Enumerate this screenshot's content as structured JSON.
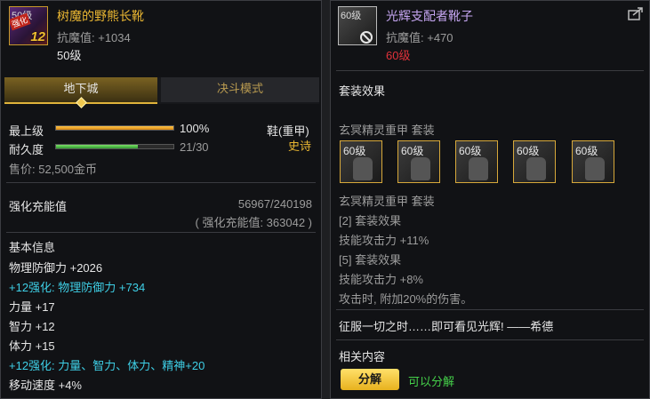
{
  "left": {
    "icon": {
      "level_text": "50级",
      "tag": "强化",
      "enhance": "12"
    },
    "item_name": "树魔的野熊长靴",
    "anti_magic": "抗魔值: +1034",
    "level": "50级",
    "tabs": [
      "地下城",
      "决斗模式"
    ],
    "highest_label": "最上级",
    "highest_value": "100%",
    "highest_ratio": 1.0,
    "durability_label": "耐久度",
    "durability_value": "21/30",
    "durability_ratio": 0.7,
    "slot_type": "鞋(重甲)",
    "rarity": "史诗",
    "price": "售价: 52,500金币",
    "amp_label": "强化充能值",
    "amp_value": "56967/240198",
    "amp_total": "( 强化充能值: 363042 )",
    "basic_header": "基本信息",
    "stats": [
      "物理防御力 +2026",
      "+12强化: 物理防御力 +734",
      "力量 +17",
      "智力 +12",
      "体力 +15",
      "+12强化: 力量、智力、体力、精神+20",
      "移动速度 +4%"
    ]
  },
  "right": {
    "icon": {
      "level_text": "60级"
    },
    "item_name": "光辉支配者靴子",
    "anti_magic": "抗魔值: +470",
    "level": "60级",
    "set_effect_header": "套装效果",
    "set_name": "玄冥精灵重甲 套装",
    "set_slots": [
      "60级",
      "60级",
      "60级",
      "60级",
      "60级"
    ],
    "set_name_2": "玄冥精灵重甲 套装",
    "set_lines": [
      "[2] 套装效果",
      "技能攻击力 +11%",
      "[5] 套装效果",
      "技能攻击力 +8%",
      "攻击时, 附加20%的伤害。"
    ],
    "flavor": "征服一切之时……即可看见光辉!  ——希德",
    "related_header": "相关内容",
    "disassemble_button": "分解",
    "disassemble_status": "可以分解"
  },
  "colors": {
    "gold": "#e8b532",
    "lavender": "#c6a6f2",
    "cyan": "#3ecfe6",
    "red": "#e0323a",
    "green": "#45d04a"
  },
  "icons": [
    "boots-icon",
    "ban-icon",
    "share-icon",
    "armor-piece-icon"
  ]
}
